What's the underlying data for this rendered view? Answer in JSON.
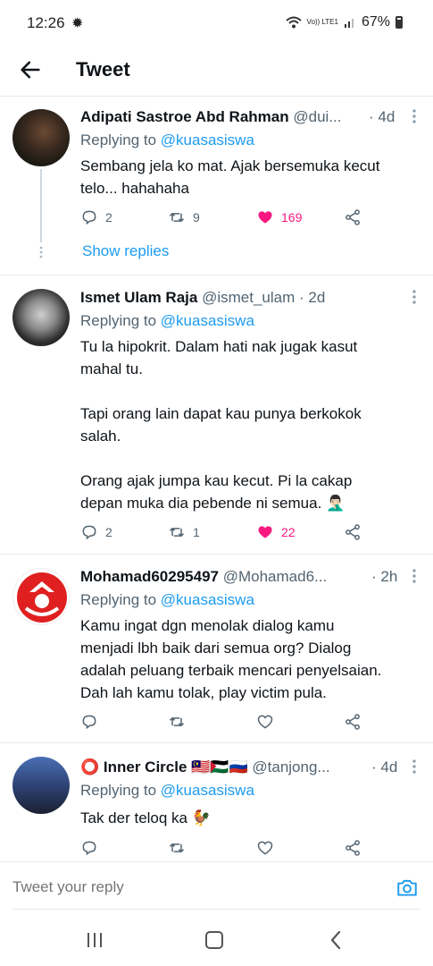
{
  "status_bar": {
    "time": "12:26",
    "battery": "67%",
    "network": "Vo)) LTE1"
  },
  "header": {
    "title": "Tweet"
  },
  "tweets": [
    {
      "name": "Adipati Sastroe Abd Rahman",
      "handle": "@dui...",
      "time": "· 4d",
      "replying_prefix": "Replying to ",
      "replying_to": "@kuasasiswa",
      "text_lines": [
        "Sembang jela ko mat. Ajak bersemuka kecut",
        "telo... hahahaha"
      ],
      "replies": "2",
      "retweets": "9",
      "likes": "169",
      "liked": true,
      "show_replies": "Show replies"
    },
    {
      "name": "Ismet Ulam Raja",
      "handle": "@ismet_ulam",
      "time": "· 2d",
      "replying_prefix": "Replying to ",
      "replying_to": "@kuasasiswa",
      "text_lines": [
        "Tu la hipokrit. Dalam hati nak jugak kasut",
        "mahal tu.",
        "",
        "Tapi orang lain dapat kau punya berkokok",
        "salah.",
        "",
        "Orang ajak jumpa kau kecut. Pi la cakap",
        "depan muka dia pebende ni semua. 🤦🏻‍♂️"
      ],
      "replies": "2",
      "retweets": "1",
      "likes": "22",
      "liked": true
    },
    {
      "name": "Mohamad60295497",
      "handle": "@Mohamad6...",
      "time": "· 2h",
      "replying_prefix": "Replying to ",
      "replying_to": "@kuasasiswa",
      "text_lines": [
        "Kamu ingat dgn menolak dialog kamu",
        "menjadi lbh baik dari semua org?  Dialog",
        "adalah peluang terbaik mencari penyelsaian.",
        "Dah lah kamu tolak,  play victim pula."
      ],
      "replies": "",
      "retweets": "",
      "likes": "",
      "liked": false
    },
    {
      "name": "⭕ Inner Circle 🇲🇾🇵🇸🇷🇺",
      "handle": "@tanjong...",
      "time": "· 4d",
      "replying_prefix": "Replying to ",
      "replying_to": "@kuasasiswa",
      "text_lines": [
        "Tak der teloq ka 🐓"
      ],
      "replies": "",
      "retweets": "",
      "likes": "",
      "liked": false
    }
  ],
  "composer": {
    "placeholder": "Tweet your reply"
  },
  "colors": {
    "accent": "#1d9bf0",
    "like": "#f91880",
    "muted": "#536471"
  },
  "icons": [
    "back-arrow-icon",
    "more-vertical-icon",
    "reply-icon",
    "retweet-icon",
    "like-icon",
    "share-icon",
    "camera-icon",
    "nav-recents-icon",
    "nav-home-icon",
    "nav-back-icon"
  ]
}
